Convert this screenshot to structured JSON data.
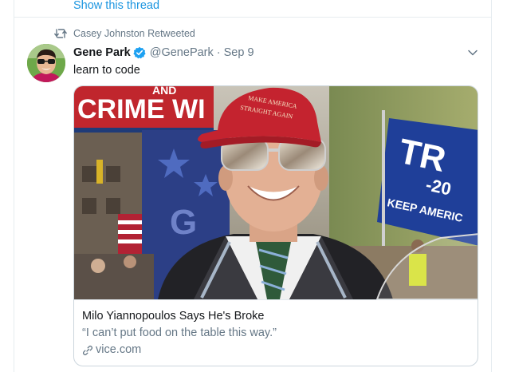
{
  "thread": {
    "show_label": "Show this thread"
  },
  "retweet": {
    "by_label": "Casey Johnston Retweeted",
    "icon": "retweet-icon"
  },
  "tweet": {
    "author_name": "Gene Park",
    "handle": "@GenePark",
    "separator": "·",
    "date": "Sep 9",
    "text": "learn to code",
    "verified": true
  },
  "card": {
    "title": "Milo Yiannopoulos Says He's Broke",
    "description": "“I can’t put food on the table this way.”",
    "domain": "vice.com",
    "image_text": {
      "banner": "CRIME WI",
      "banner_top": "AND",
      "hat_line1": "MAKE AMERICA",
      "hat_line2": "STRAIGHT AGAIN",
      "flag_big": "TR",
      "flag_year": "-20",
      "flag_bottom": "KEEP AMERIC",
      "poster": "G"
    }
  },
  "colors": {
    "link": "#1b95e0",
    "muted": "#657786",
    "border": "#e6ecf0"
  }
}
